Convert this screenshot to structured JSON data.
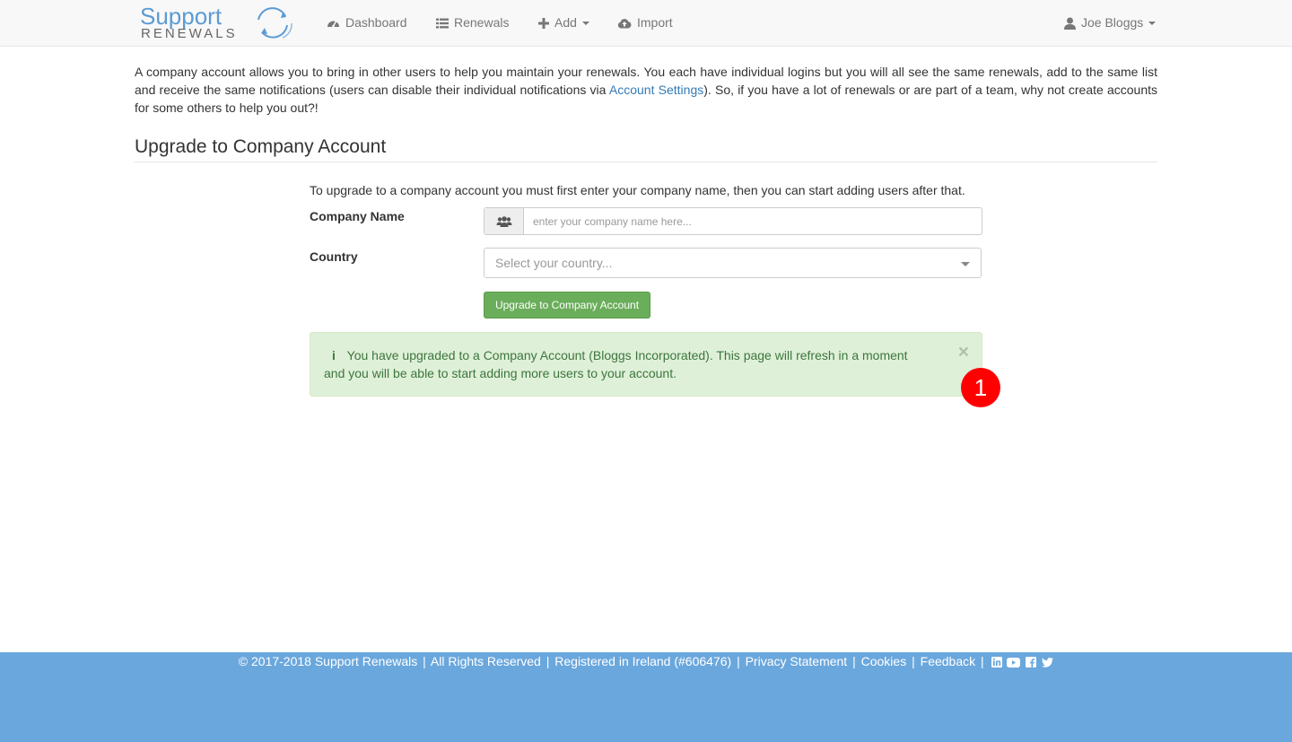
{
  "brand": {
    "logo_top": "Support",
    "logo_bottom": "RENEWALS"
  },
  "nav": {
    "dashboard": "Dashboard",
    "renewals": "Renewals",
    "add": "Add",
    "import": "Import",
    "user": "Joe Bloggs"
  },
  "intro": {
    "text_before": "A company account allows you to bring in other users to help you maintain your renewals. You each have individual logins but you will all see the same renewals, add to the same list and receive the same notifications (users can disable their individual notifications via ",
    "link": "Account Settings",
    "text_after": "). So, if you have a lot of renewals or are part of a team, why not create accounts for some others to help you out?!"
  },
  "section": {
    "title": "Upgrade to Company Account",
    "help": "To upgrade to a company account you must first enter your company name, then you can start adding users after that."
  },
  "form": {
    "company_label": "Company Name",
    "company_placeholder": "enter your company name here...",
    "country_label": "Country",
    "country_placeholder": "Select your country...",
    "submit": "Upgrade to Company Account"
  },
  "alert": {
    "icon": "i",
    "message": "You have upgraded to a Company Account (Bloggs Incorporated). This page will refresh in a moment and you will be able to start adding more users to your account.",
    "close": "×"
  },
  "badge": "1",
  "footer": {
    "copyright_symbol": "©",
    "copyright": "2017-2018 Support Renewals",
    "rights": "All Rights Reserved",
    "registered": "Registered in Ireland (#606476)",
    "privacy": "Privacy Statement",
    "cookies": "Cookies",
    "feedback": "Feedback",
    "separator": "|"
  },
  "colors": {
    "accent": "#337ab7",
    "success": "#6aad5a",
    "alert_bg": "#dff0d8",
    "footer_bg": "#6aa7dd",
    "badge": "#ff0000"
  },
  "icons": [
    "dashboard-icon",
    "list-icon",
    "plus-icon",
    "cloud-upload-icon",
    "user-icon",
    "users-icon",
    "info-icon",
    "close-icon",
    "copyright-icon",
    "linkedin-icon",
    "youtube-icon",
    "facebook-icon",
    "twitter-icon"
  ]
}
